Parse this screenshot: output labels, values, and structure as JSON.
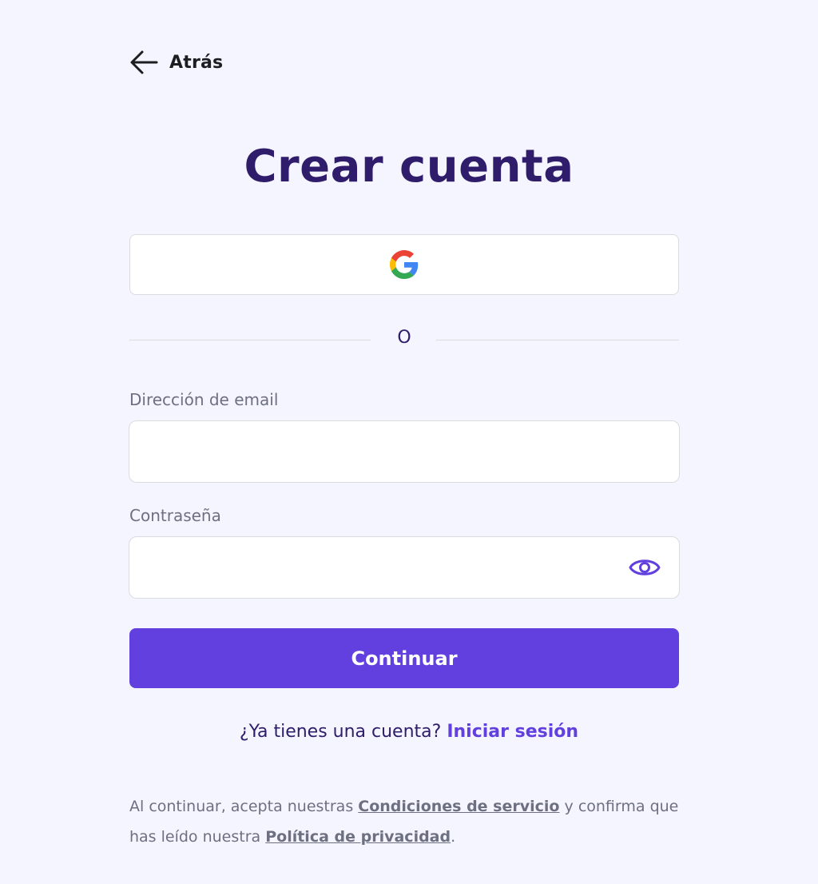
{
  "nav": {
    "back_label": "Atrás"
  },
  "page": {
    "title": "Crear cuenta"
  },
  "social": {
    "provider": "google-icon"
  },
  "divider": {
    "text": "O"
  },
  "form": {
    "email_label": "Dirección de email",
    "email_value": "",
    "password_label": "Contraseña",
    "password_value": "",
    "submit_label": "Continuar"
  },
  "signin": {
    "prompt": "¿Ya tienes una cuenta?",
    "link_label": "Iniciar sesión"
  },
  "legal": {
    "text_1": "Al continuar, acepta nuestras",
    "terms_link": "Condiciones de servicio",
    "text_2": "y confirma que has leído nuestra",
    "privacy_link": "Política de privacidad",
    "text_3": "."
  },
  "colors": {
    "background": "#f4f5ff",
    "title": "#2f1c6a",
    "accent": "#6140df",
    "muted_text": "#6d7081"
  }
}
